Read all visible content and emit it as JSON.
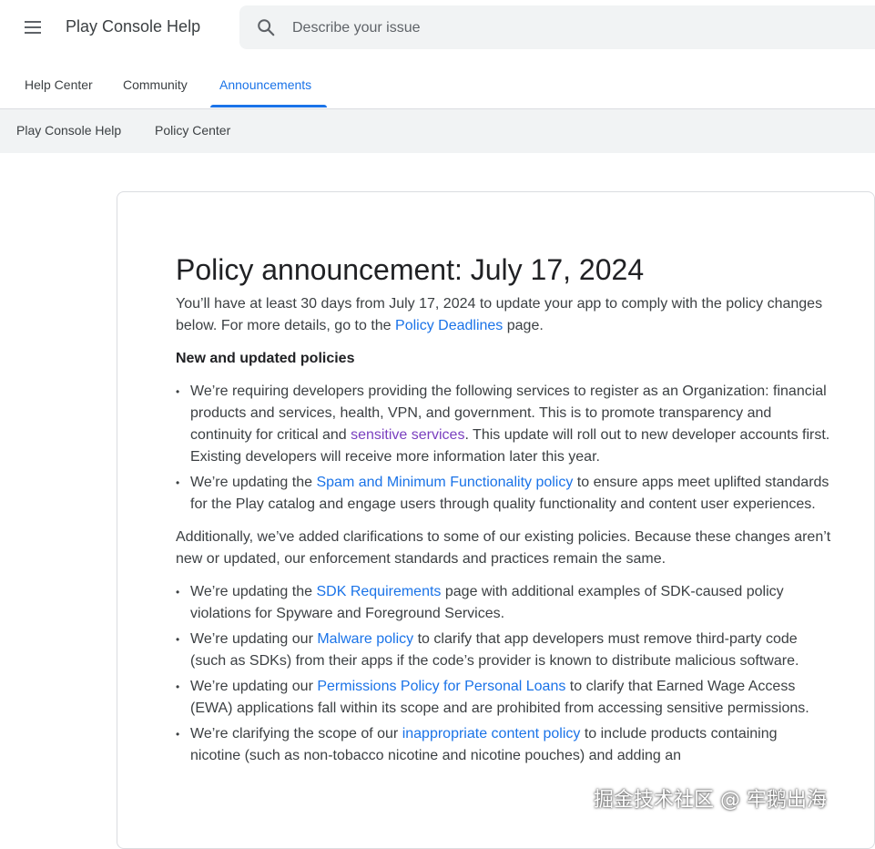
{
  "header": {
    "app_title": "Play Console Help",
    "search": {
      "placeholder": "Describe your issue",
      "value": ""
    },
    "menu_icon": "hamburger-menu-icon",
    "search_icon": "search-icon"
  },
  "tabs": [
    {
      "label": "Help Center",
      "active": false
    },
    {
      "label": "Community",
      "active": false
    },
    {
      "label": "Announcements",
      "active": true
    }
  ],
  "subnav": [
    {
      "label": "Play Console Help"
    },
    {
      "label": "Policy Center"
    }
  ],
  "article": {
    "title": "Policy announcement: July 17, 2024",
    "intro_before": "You’ll have at least 30 days from July 17, 2024 to update your app to comply with the policy changes below. For more details, go to the ",
    "intro_link": "Policy Deadlines",
    "intro_after": " page.",
    "section_title": "New and updated policies",
    "new_policies": [
      {
        "before": "We’re requiring developers providing the following services to register as an Organization: financial products and services, health, VPN, and government. This is to promote transparency and continuity for critical and ",
        "link": "sensitive services",
        "after": ". This update will roll out to new developer accounts first. Existing developers will receive more information later this year."
      },
      {
        "before": "We’re updating the ",
        "link": "Spam and Minimum Functionality policy",
        "after": " to ensure apps meet uplifted standards for the Play catalog and engage users through quality functionality and content user experiences."
      }
    ],
    "additional": "Additionally, we’ve added clarifications to some of our existing policies. Because these changes aren’t new or updated, our enforcement standards and practices remain the same.",
    "clarifications": [
      {
        "before": "We’re updating the ",
        "link": "SDK Requirements",
        "after": " page with additional examples of SDK-caused policy violations for Spyware and Foreground Services."
      },
      {
        "before": "We’re updating our ",
        "link": "Malware policy",
        "after": " to clarify that app developers must remove third-party code (such as SDKs) from their apps if the code’s provider is known to distribute malicious software."
      },
      {
        "before": "We’re updating our ",
        "link": "Permissions Policy for Personal Loans",
        "after": " to clarify that Earned Wage Access (EWA) applications fall within its scope and are prohibited from accessing sensitive permissions."
      },
      {
        "before": "We’re clarifying the scope of our ",
        "link": "inappropriate content policy",
        "after": " to include products containing nicotine (such as non-tobacco nicotine and nicotine pouches) and adding an"
      }
    ]
  },
  "watermark": "掘金技术社区 @ 牢鹅出海",
  "colors": {
    "accent": "#1a73e8",
    "visited_link": "#7a3fbf",
    "subnav_bg": "#f1f3f4"
  }
}
